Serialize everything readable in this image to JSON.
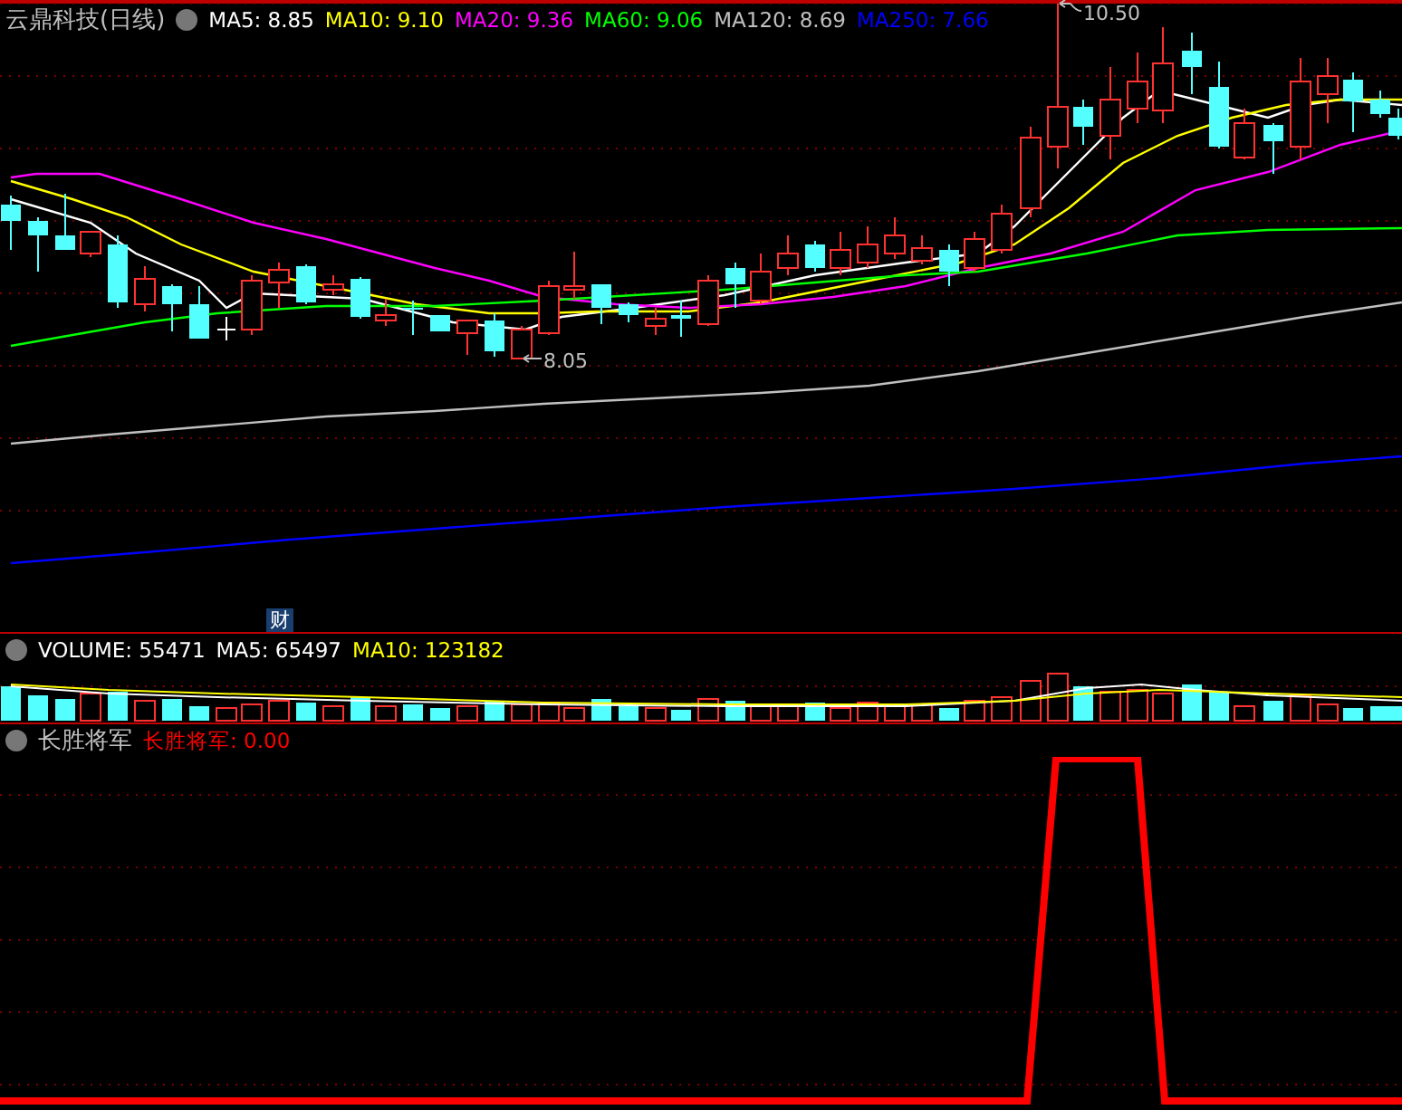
{
  "main_panel": {
    "title": "云鼎科技(日线)",
    "legend": [
      {
        "label": "MA5: 8.85",
        "color": "#ffffff"
      },
      {
        "label": "MA10: 9.10",
        "color": "#ffff00"
      },
      {
        "label": "MA20: 9.36",
        "color": "#ff00ff"
      },
      {
        "label": "MA60: 9.06",
        "color": "#00ff00"
      },
      {
        "label": "MA120: 8.69",
        "color": "#c0c0c0"
      },
      {
        "label": "MA250: 7.66",
        "color": "#0000ff"
      }
    ],
    "high_label": "10.50",
    "low_label": "8.05",
    "badge": "财"
  },
  "volume_panel": {
    "legend": [
      {
        "label": "VOLUME: 55471",
        "color": "#ffffff"
      },
      {
        "label": "MA5: 65497",
        "color": "#ffffff"
      },
      {
        "label": "MA10: 123182",
        "color": "#ffff00"
      }
    ]
  },
  "indicator_panel": {
    "title": "长胜将军",
    "legend": [
      {
        "label": "长胜将军: 0.00",
        "color": "#ff0000"
      }
    ]
  }
}
